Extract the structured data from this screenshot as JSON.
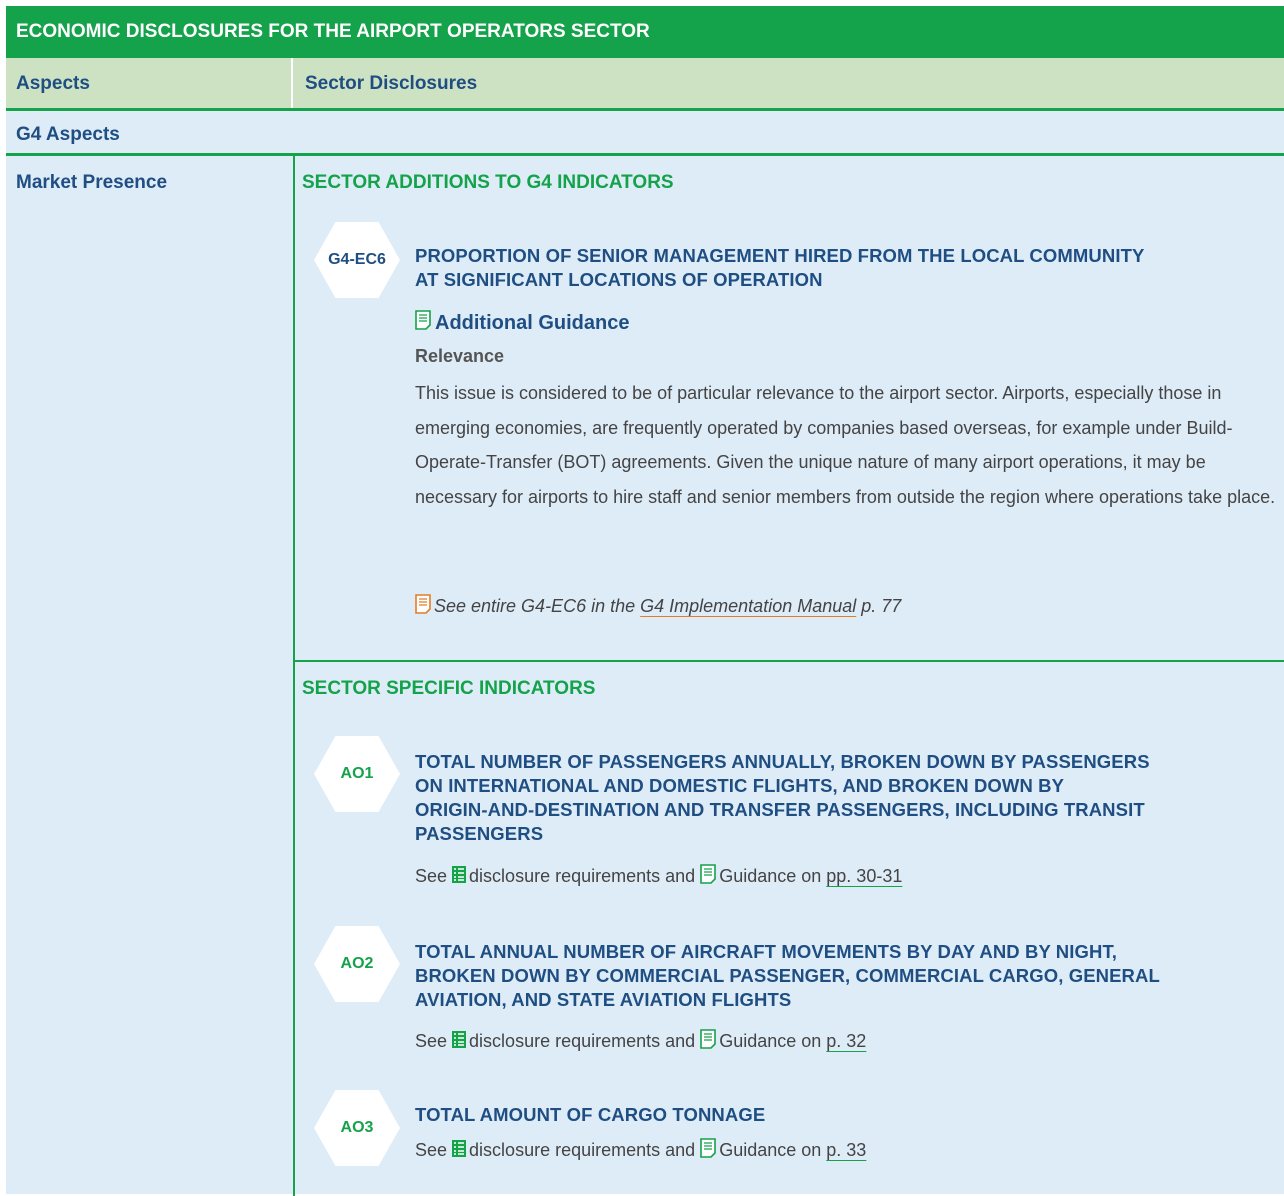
{
  "title": "ECONOMIC DISCLOSURES FOR THE AIRPORT OPERATORS SECTOR",
  "headers": {
    "aspects": "Aspects",
    "sector_disclosures": "Sector Disclosures"
  },
  "g4_aspects": "G4 Aspects",
  "aspect": "Market Presence",
  "sections": {
    "additions": "SECTOR ADDITIONS TO G4 INDICATORS",
    "specific": "SECTOR SPECIFIC INDICATORS"
  },
  "ec6": {
    "code": "G4-EC6",
    "title_line1": "PROPORTION OF SENIOR MANAGEMENT HIRED FROM THE LOCAL COMMUNITY",
    "title_line2": "AT SIGNIFICANT LOCATIONS OF OPERATION",
    "additional_guidance": "Additional Guidance",
    "relevance_label": "Relevance",
    "paragraph": "This issue is considered to be of particular relevance to the airport sector. Airports, especially those in emerging economies, are frequently operated by companies based overseas, for example under Build-Operate-Transfer (BOT) agreements. Given the unique nature of many airport operations, it may be necessary for airports to hire staff and senior members from outside the region where operations take place.",
    "see_prefix": "See entire G4-EC6 in the",
    "see_link": "G4 Implementation Manual",
    "see_suffix": "p. 77"
  },
  "see_word": "See",
  "disclosure_text": "disclosure requirements and",
  "guidance_text": "Guidance on",
  "indicators": [
    {
      "code": "AO1",
      "lines": [
        "TOTAL NUMBER OF PASSENGERS ANNUALLY, BROKEN DOWN BY PASSENGERS",
        "ON INTERNATIONAL AND DOMESTIC FLIGHTS, AND BROKEN DOWN BY",
        "ORIGIN-AND-DESTINATION AND TRANSFER PASSENGERS, INCLUDING TRANSIT",
        "PASSENGERS"
      ],
      "pages": "pp. 30-31"
    },
    {
      "code": "AO2",
      "lines": [
        "TOTAL ANNUAL NUMBER OF AIRCRAFT MOVEMENTS BY DAY AND BY NIGHT,",
        "BROKEN DOWN BY COMMERCIAL PASSENGER, COMMERCIAL CARGO, GENERAL",
        "AVIATION, AND STATE AVIATION FLIGHTS"
      ],
      "pages": "p. 32"
    },
    {
      "code": "AO3",
      "lines": [
        "TOTAL AMOUNT OF CARGO TONNAGE"
      ],
      "pages": "p. 33"
    }
  ],
  "colors": {
    "green": "#14a24a",
    "navy": "#1f4e82",
    "light_blue": "#deecf8",
    "header_green": "#cde2c3",
    "orange": "#e57c23"
  }
}
